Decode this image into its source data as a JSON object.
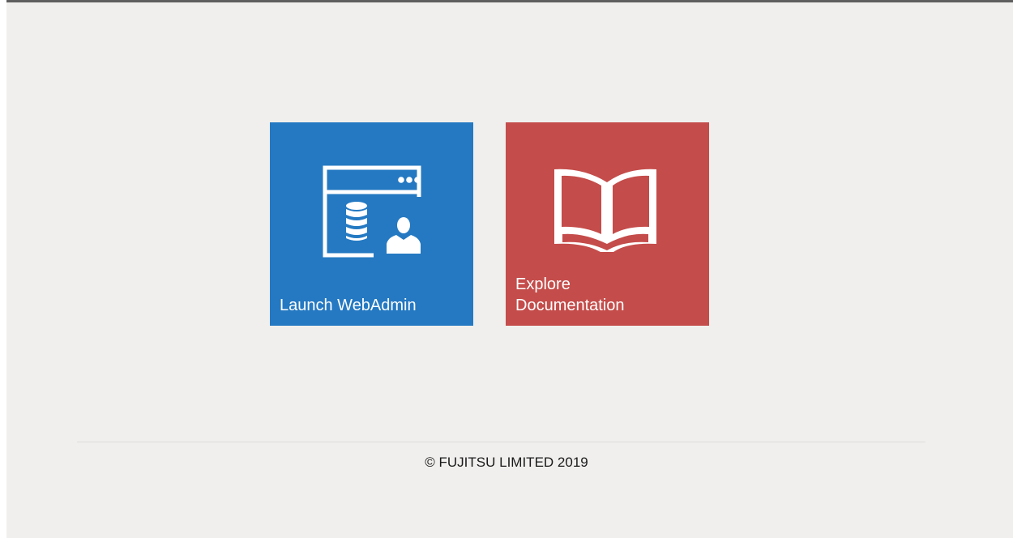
{
  "tiles": {
    "webadmin": {
      "label": "Launch WebAdmin",
      "color": "#2479c2",
      "icon": "webadmin-database-user-icon"
    },
    "docs": {
      "label": "Explore\nDocumentation",
      "color": "#c44c4a",
      "icon": "open-book-icon"
    }
  },
  "footer": {
    "copyright": "© FUJITSU LIMITED 2019"
  },
  "colors": {
    "background": "#f0efed",
    "top_bar": "#5f5f5f"
  }
}
